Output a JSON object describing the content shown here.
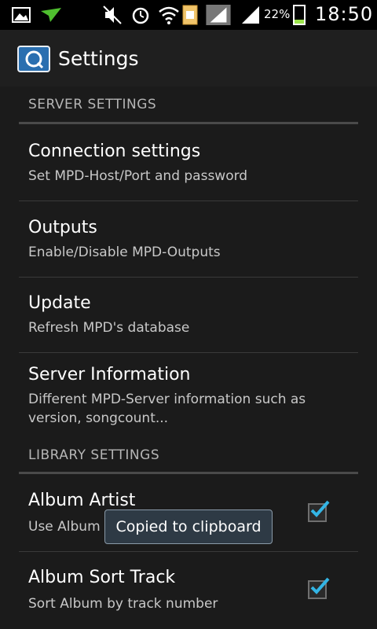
{
  "status_bar": {
    "battery_percent_label": "22%",
    "battery_level": 0.22,
    "time": "18:50",
    "icons": [
      "gallery-icon",
      "send-icon",
      "mute-icon",
      "alarm-icon",
      "wifi-icon",
      "sim-card-icon",
      "signal-icon",
      "signal-icon",
      "battery-icon"
    ]
  },
  "header": {
    "title": "Settings",
    "app_icon": "mpd-app-icon"
  },
  "sections": {
    "server": {
      "label": "SERVER SETTINGS",
      "items": [
        {
          "title": "Connection settings",
          "summary": "Set MPD-Host/Port and password"
        },
        {
          "title": "Outputs",
          "summary": "Enable/Disable MPD-Outputs"
        },
        {
          "title": "Update",
          "summary": "Refresh MPD's database"
        },
        {
          "title": "Server Information",
          "summary": "Different MPD-Server information such as version, songcount..."
        }
      ]
    },
    "library": {
      "label": "LIBRARY SETTINGS",
      "items": [
        {
          "title": "Album Artist",
          "summary": "Use Album",
          "checked": true
        },
        {
          "title": "Album Sort Track",
          "summary": "Sort Album by track number",
          "checked": true
        }
      ]
    }
  },
  "toast": {
    "text": "Copied to clipboard"
  },
  "colors": {
    "background": "#1b1b1b",
    "accent": "#33b5e5",
    "battery_fill": "#9be34a"
  }
}
